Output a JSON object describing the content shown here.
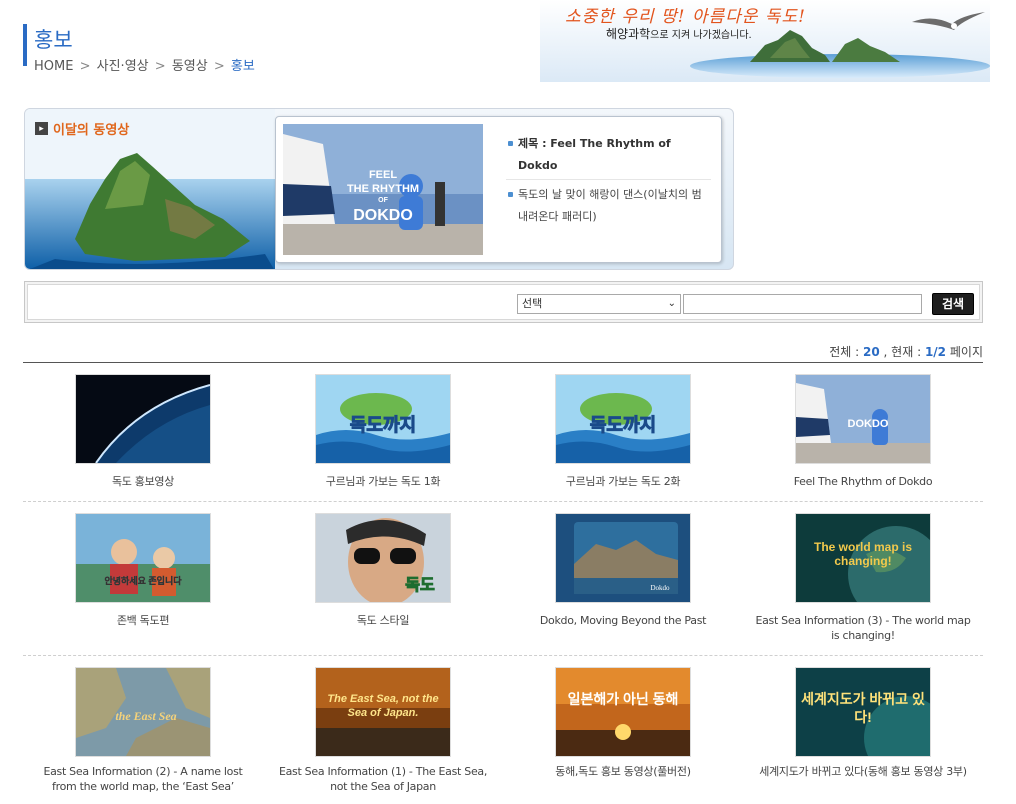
{
  "header": {
    "title": "홍보",
    "breadcrumb": [
      "HOME",
      "사진·영상",
      "동영상",
      "홍보"
    ],
    "banner_slogan": "소중한 우리 땅! 아름다운 독도!",
    "banner_sub": "해양과학",
    "banner_sub2": "으로 지켜 나가겠습니다."
  },
  "featured": {
    "label": "이달의 동영상",
    "thumb_text": [
      "FEEL",
      "THE RHYTHM",
      "OF",
      "DOKDO"
    ],
    "title_line": "제목 : Feel The Rhythm of Dokdo",
    "desc": "독도의 날 맞이 해랑이 댄스(이날치의 범 내려온다 패러디)"
  },
  "search": {
    "select_value": "선택",
    "input_value": "",
    "button_label": "검색"
  },
  "count": {
    "total_label": "전체 :",
    "total": "20",
    "current_label": ", 현재 :",
    "current": "1/2",
    "unit": "페이지"
  },
  "videos": [
    [
      {
        "title": "독도 홍보영상",
        "thumb": "earth"
      },
      {
        "title": "구르님과 가보는 독도 1화",
        "thumb": "cartoon",
        "thumb_text": "독도까지"
      },
      {
        "title": "구르님과 가보는 독도 2화",
        "thumb": "cartoon",
        "thumb_text": "독도까지"
      },
      {
        "title": "Feel The Rhythm of Dokdo",
        "thumb": "ship",
        "thumb_text": "DOKDO"
      }
    ],
    [
      {
        "title": "존백 독도편",
        "thumb": "kids",
        "thumb_text": "안녕하세요 존입니다"
      },
      {
        "title": "독도 스타일",
        "thumb": "sunglasses",
        "thumb_text": "독도"
      },
      {
        "title": "Dokdo, Moving Beyond the Past",
        "thumb": "dokdo",
        "thumb_text": "Dokdo"
      },
      {
        "title": "East Sea Information (3) - The world map is changing!",
        "thumb": "globe",
        "thumb_text": "The world map is changing!"
      }
    ],
    [
      {
        "title": "East Sea Information (2) - A name lost from the world map, the ‘East Sea’",
        "thumb": "map",
        "thumb_text": "the East Sea"
      },
      {
        "title": "East Sea Information (1) - The East Sea, not the Sea of Japan",
        "thumb": "orange",
        "thumb_text": "The East Sea, not the Sea of Japan."
      },
      {
        "title": "동해,독도 홍보 동영상(풀버전)",
        "thumb": "sunset",
        "thumb_text": "일본해가 아닌 동해"
      },
      {
        "title": "세계지도가 바뀌고 있다(동해 홍보 동영상 3부)",
        "thumb": "teal",
        "thumb_text": "세계지도가 바뀌고 있다!"
      }
    ]
  ],
  "colors": {
    "accent": "#2a6bc4",
    "featured_label": "#e0661b",
    "button_bg": "#1e1e1e"
  }
}
